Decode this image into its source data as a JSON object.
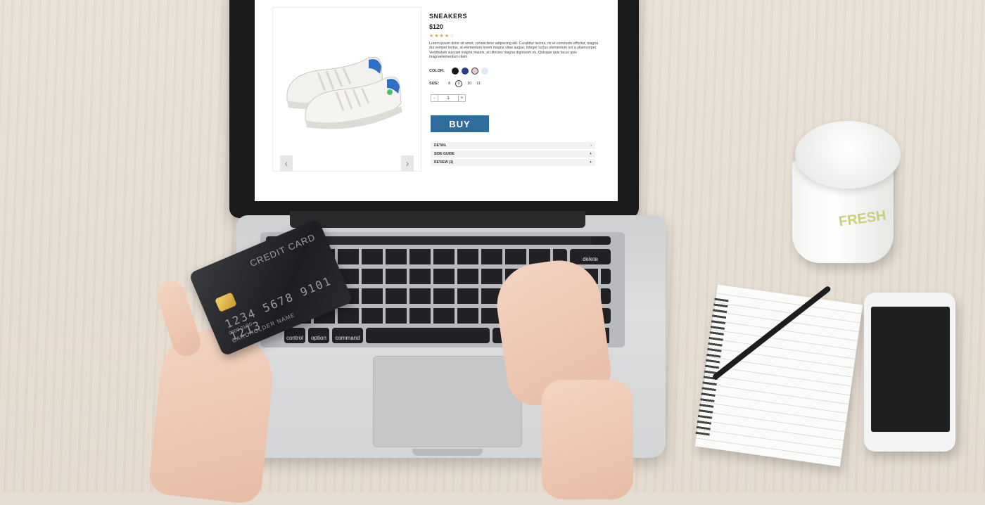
{
  "product": {
    "title": "SNEAKERS",
    "price": "$120",
    "rating_stars": "★★★★☆",
    "description": "Lorem ipsum dolor sit amet, consectetur adipiscing elit. Curabitur lacinia, mi et commodo efficitur, magna dui semper lectus, at elementum lorem magna vitae augue. Integer luctus elementum est a ullamcorper. Vestibulum suscipit magna mauris, at ultricies magna dignissim eu. Quisque quis lacus quis magnaelementum diam.",
    "color_label": "COLOR:",
    "colors": [
      "#1a1a1a",
      "#2d3f8c",
      "#e8c9d6",
      "#dfe9f3"
    ],
    "size_label": "SIZE:",
    "sizes": [
      "8",
      "9",
      "10",
      "11"
    ],
    "selected_size": "9",
    "quantity": "1",
    "qty_minus": "-",
    "qty_plus": "+",
    "buy_label": "BUY",
    "accordion": [
      {
        "label": "DETAIL",
        "sign": "-"
      },
      {
        "label": "SIDE GUIDE",
        "sign": "+"
      },
      {
        "label": "REVIEW (1)",
        "sign": "+"
      }
    ],
    "prev_icon": "chevron-left-icon",
    "next_icon": "chevron-right-icon"
  },
  "card": {
    "title": "CREDIT CARD",
    "number": "1234 5678 9101 1213",
    "sub": "0000   01/00",
    "holder": "CARDHOLDER NAME"
  },
  "keyboard": {
    "control": "control",
    "option": "option",
    "command": "command",
    "delete": "delete"
  },
  "cup_print": "FRESH"
}
